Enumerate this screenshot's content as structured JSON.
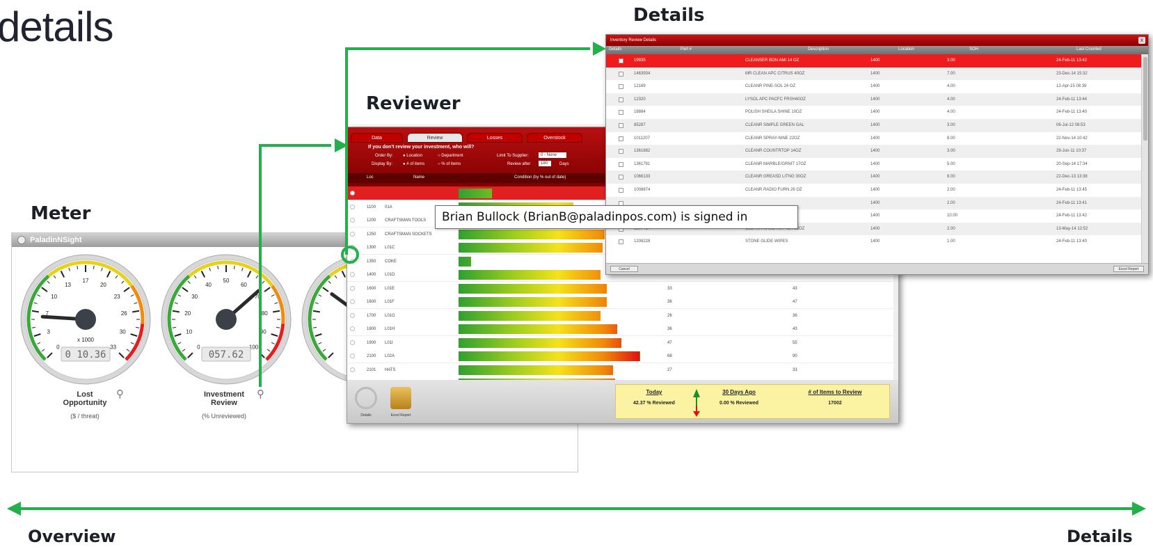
{
  "page": {
    "title": "details",
    "labels": {
      "meter": "Meter",
      "reviewer": "Reviewer",
      "details_top": "Details",
      "overview": "Overview",
      "details_bottom": "Details"
    }
  },
  "colors": {
    "arrow_green": "#22b04b",
    "brand_red": "#c00000"
  },
  "meter": {
    "title": "PaladinNSight",
    "gauges": [
      {
        "caption": "Lost\nOpportunity",
        "sub": "($ / threat)",
        "readout": "0 10.36",
        "multiplier": "x 1000",
        "ticks": [
          "0",
          "3",
          "7",
          "10",
          "13",
          "17",
          "20",
          "23",
          "26",
          "30",
          "33"
        ],
        "icon": "search-icon"
      },
      {
        "caption": "Investment\nReview",
        "sub": "(% Unreviewed)",
        "readout": "057.62",
        "multiplier": "",
        "ticks": [
          "0",
          "10",
          "20",
          "30",
          "40",
          "50",
          "60",
          "70",
          "80",
          "90",
          "100"
        ],
        "icon": "search-icon"
      }
    ]
  },
  "reviewer": {
    "tabs": [
      "Data",
      "Review",
      "Losses",
      "Overstock"
    ],
    "active_tab": 1,
    "question": "If you don't review your investment, who will?",
    "order_by_label": "Order By:",
    "order_by_options": [
      "Location",
      "Department"
    ],
    "display_by_label": "Display By:",
    "display_by_options": [
      "# of items",
      "% of items"
    ],
    "limit_label": "Limit To Supplier:",
    "limit_value": "0 - None",
    "review_after_label": "Review after",
    "review_after_value": "180",
    "review_after_unit": "Days",
    "columns": [
      "Loc",
      "Name",
      "Condition (by % out of date)"
    ],
    "rows": [
      {
        "loc": "",
        "name": "",
        "pct": 0.16,
        "v1": "",
        "v2": "",
        "selected": true
      },
      {
        "loc": "1100",
        "name": "01A",
        "pct": 0.55,
        "v1": "",
        "v2": ""
      },
      {
        "loc": "1200",
        "name": "CRAFTSMAN TOOLS",
        "pct": 0.78,
        "v1": "",
        "v2": ""
      },
      {
        "loc": "1250",
        "name": "CRAFTSMAN SOCKETS",
        "pct": 0.7,
        "v1": "",
        "v2": ""
      },
      {
        "loc": "1300",
        "name": "L01C",
        "pct": 0.69,
        "v1": "",
        "v2": ""
      },
      {
        "loc": "1350",
        "name": "COKE",
        "pct": 0.06,
        "v1": "",
        "v2": ""
      },
      {
        "loc": "1400",
        "name": "L01D",
        "pct": 0.68,
        "v1": "",
        "v2": ""
      },
      {
        "loc": "1600",
        "name": "L01E",
        "pct": 0.71,
        "v1": "33",
        "v2": "43"
      },
      {
        "loc": "1600",
        "name": "L01F",
        "pct": 0.71,
        "v1": "36",
        "v2": "47"
      },
      {
        "loc": "1700",
        "name": "L01G",
        "pct": 0.68,
        "v1": "26",
        "v2": "36"
      },
      {
        "loc": "1800",
        "name": "L01H",
        "pct": 0.76,
        "v1": "36",
        "v2": "43"
      },
      {
        "loc": "1900",
        "name": "L01I",
        "pct": 0.78,
        "v1": "47",
        "v2": "55"
      },
      {
        "loc": "2100",
        "name": "L02A",
        "pct": 0.87,
        "v1": "68",
        "v2": "90"
      },
      {
        "loc": "2101",
        "name": "HATS",
        "pct": 0.74,
        "v1": "27",
        "v2": "33"
      },
      {
        "loc": "2200",
        "name": "L02B",
        "pct": 0.75,
        "v1": "47",
        "v2": "56"
      }
    ],
    "footer_buttons": [
      "Details",
      "Excel Report"
    ],
    "summary": {
      "today_label": "Today",
      "today_value": "42.37 % Reviewed",
      "ago_label": "30 Days Ago",
      "ago_value": "0.00 % Reviewed",
      "items_label": "# of Items to Review",
      "items_value": "17002"
    }
  },
  "tooltip": "Brian Bullock (BrianB@paladinpos.com) is signed in",
  "details": {
    "title": "Inventory Review Details",
    "close": "x",
    "columns": [
      "Details",
      "Part #",
      "Description",
      "Location",
      "SOH",
      "Last Counted"
    ],
    "rows": [
      {
        "part": "19935",
        "desc": "CLEANSER BON AMI 14 OZ",
        "loc": "1400",
        "soh": "3.00",
        "last": "24-Feb-11 13:42",
        "selected": true
      },
      {
        "part": "1463934",
        "desc": "MR CLEAN APC CITRUS 40OZ",
        "loc": "1400",
        "soh": "7.00",
        "last": "23-Dec-14 15:32"
      },
      {
        "part": "12189",
        "desc": "CLEANR PINE-SOL 24 OZ",
        "loc": "1400",
        "soh": "4.00",
        "last": "12-Apr-15 08:39"
      },
      {
        "part": "12320",
        "desc": "LYSOL APC PACFC FRSH40OZ",
        "loc": "1400",
        "soh": "4.00",
        "last": "24-Feb-11 13:44"
      },
      {
        "part": "18884",
        "desc": "POLISH SHEILA SHINE 10OZ",
        "loc": "1400",
        "soh": "4.00",
        "last": "24-Feb-11 13:40"
      },
      {
        "part": "85287",
        "desc": "CLEANR SIMPLE GREEN GAL",
        "loc": "1400",
        "soh": "3.00",
        "last": "06-Jul-12 08:53"
      },
      {
        "part": "1011207",
        "desc": "CLEANR SPRAY-NINE 22OZ",
        "loc": "1400",
        "soh": "8.00",
        "last": "22-Nov-14 10:42"
      },
      {
        "part": "1361682",
        "desc": "CLEANR COUNTRTOP 14OZ",
        "loc": "1400",
        "soh": "3.00",
        "last": "29-Jun-11 10:37"
      },
      {
        "part": "1361781",
        "desc": "CLEANR MARBLE/GRNIT 17OZ",
        "loc": "1400",
        "soh": "5.00",
        "last": "20-Sep-14 17:34"
      },
      {
        "part": "1066133",
        "desc": "CLEANR GREASD LITNG 30OZ",
        "loc": "1400",
        "soh": "8.00",
        "last": "22-Dec-13 13:38"
      },
      {
        "part": "1008874",
        "desc": "CLEANR RADIO FURN 26 OZ",
        "loc": "1400",
        "soh": "2.00",
        "last": "24-Feb-11 13:45"
      },
      {
        "part": "",
        "desc": "",
        "loc": "1400",
        "soh": "2.00",
        "last": "24-Feb-11 13:41"
      },
      {
        "part": "",
        "desc": "",
        "loc": "1400",
        "soh": "10.00",
        "last": "24-Feb-11 13:42"
      },
      {
        "part": "1207414",
        "desc": "CLEANR KRUD KUTTER 32OZ",
        "loc": "1400",
        "soh": "2.00",
        "last": "13-May-14 12:52"
      },
      {
        "part": "1208228",
        "desc": "STONE GLIDE WIPES",
        "loc": "1400",
        "soh": "1.00",
        "last": "24-Feb-11 13:40"
      }
    ],
    "footer_left": "Cancel",
    "footer_right": "Excel Report"
  }
}
